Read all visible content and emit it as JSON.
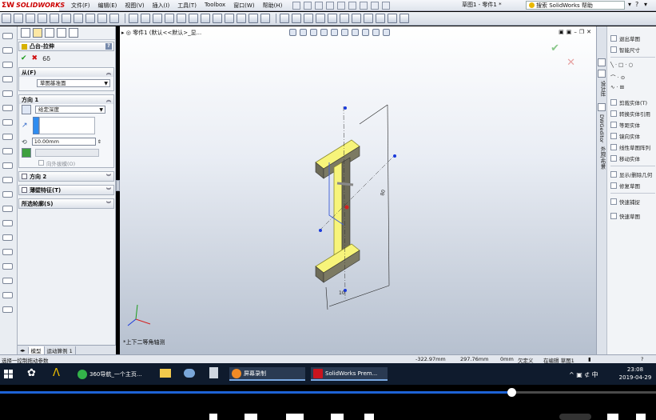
{
  "app": {
    "brand": "SOLIDWORKS",
    "menu": [
      "文件(F)",
      "编辑(E)",
      "视图(V)",
      "插入(I)",
      "工具(T)",
      "Toolbox",
      "窗口(W)",
      "帮助(H)"
    ],
    "doc_title": "草图1 - 零件1 *",
    "help_search": "搜索 SolidWorks 帮助"
  },
  "property_manager": {
    "title": "凸台-拉伸",
    "help": "?",
    "from_group": {
      "label": "从(F)",
      "value": "草图基准面"
    },
    "direction1": {
      "label": "方向 1",
      "end_condition": "给定深度",
      "depth": "10.00mm",
      "draft_label": "向外拔模(O)"
    },
    "direction2_label": "方向 2",
    "thin_feature_label": "薄壁特征(T)",
    "selected_contours_label": "所选轮廓(S)"
  },
  "bottom_tabs": [
    "模型",
    "运动算例 1"
  ],
  "viewport": {
    "title": "零件1 (默认<<默认>_显...",
    "view_name": "*上下二等角轴测",
    "dim_depth": "10",
    "dim_height": "80"
  },
  "task_pane": {
    "vertical_labels": [
      "设计库",
      "DWGeditor",
      "外观/布景"
    ]
  },
  "command_panel": {
    "items": [
      "退出草图",
      "智能尺寸",
      "剪裁实体(T)",
      "转换实体引用",
      "等距实体",
      "镜向实体",
      "线性草图阵列",
      "移动实体",
      "显示/删除几何",
      "修复草图",
      "快速捕捉",
      "快速草图"
    ]
  },
  "statusbar": {
    "hint": "选择一控制拖动参数",
    "x": "-322.97mm",
    "y": "297.76mm",
    "z": "0mm",
    "state": "欠定义",
    "editing": "在编辑 草图1",
    "help": "?"
  },
  "taskbar": {
    "apps": [
      "360导航_一个主页...",
      "屏幕录制",
      "SolidWorks Prem..."
    ],
    "tray": "^ ▣ ⊄ 中",
    "time": "23:08",
    "date": "2019-04-29"
  },
  "player": {
    "progress": 0.78
  },
  "colors": {
    "accent_blue": "#1e63d6",
    "ok_green": "#1a9b1a",
    "cancel_red": "#d01010",
    "part_yellow": "#f7f47a"
  }
}
